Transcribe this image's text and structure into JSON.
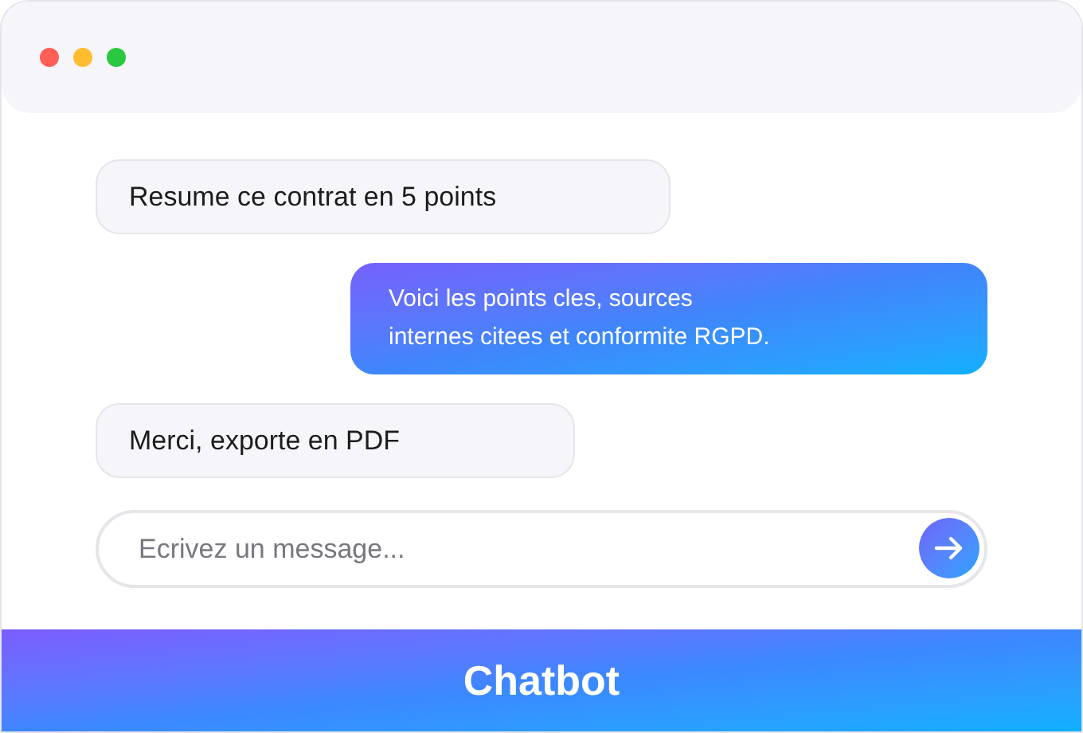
{
  "window": {
    "controls": [
      {
        "color": "#ff5f57"
      },
      {
        "color": "#febc2e"
      },
      {
        "color": "#28c840"
      }
    ]
  },
  "messages": [
    {
      "kind": "user",
      "lines": [
        "Resume ce contrat en 5 points"
      ]
    },
    {
      "kind": "bot",
      "lines": [
        "Voici les points cles, sources",
        "internes citees et conformite RGPD."
      ]
    },
    {
      "kind": "user",
      "lines": [
        "Merci, exporte en PDF"
      ]
    }
  ],
  "composer": {
    "placeholder": "Ecrivez un message..."
  },
  "footer": {
    "title": "Chatbot"
  }
}
